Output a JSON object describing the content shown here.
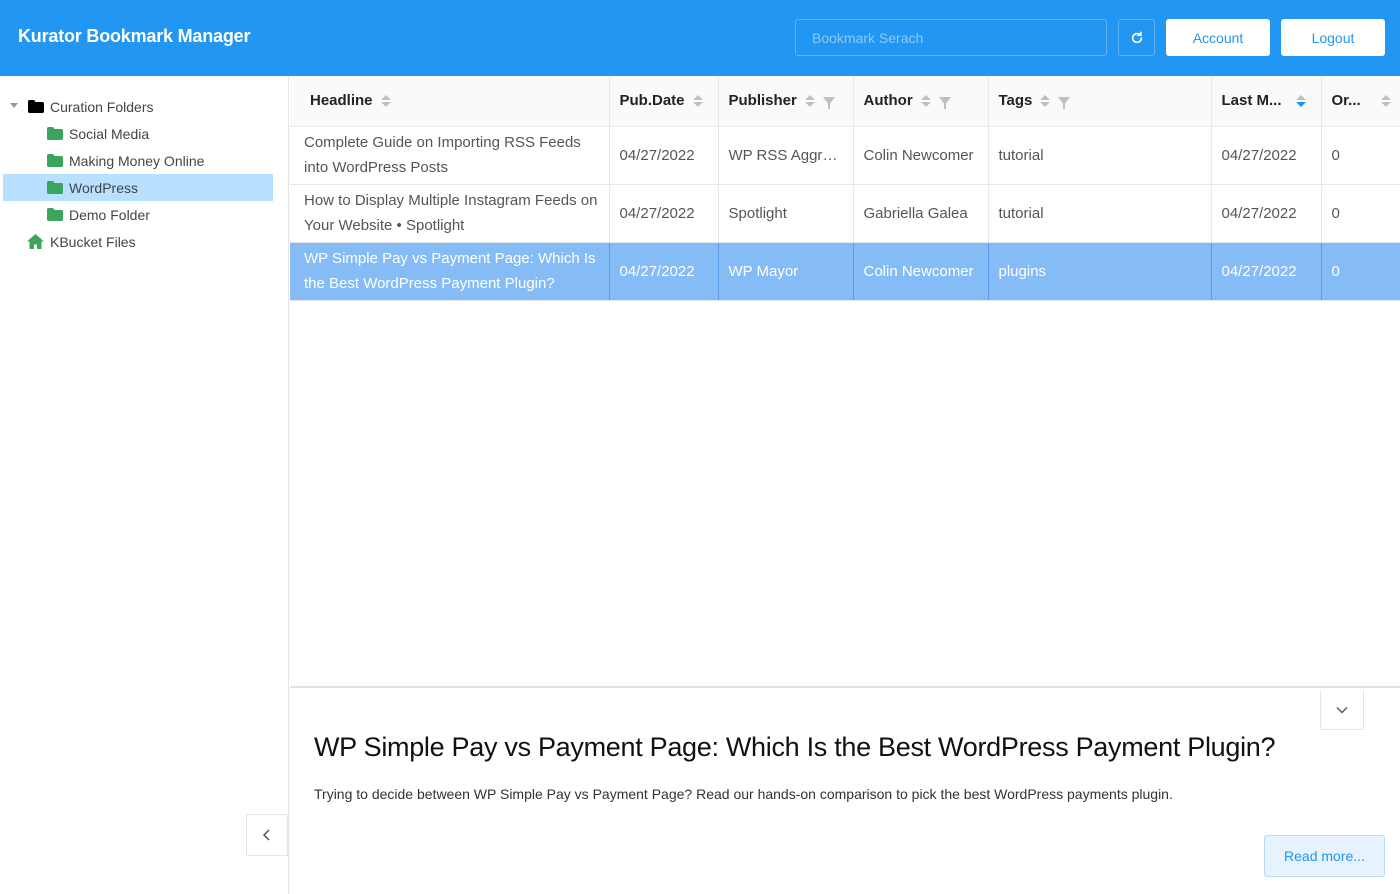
{
  "header": {
    "title": "Kurator Bookmark Manager",
    "search_placeholder": "Bookmark Serach",
    "account_label": "Account",
    "logout_label": "Logout"
  },
  "sidebar": {
    "root": {
      "label": "Curation Folders",
      "icon": "folder-icon"
    },
    "folders": [
      {
        "label": "Social Media",
        "icon": "folder-icon",
        "color": "#3ba55d"
      },
      {
        "label": "Making Money Online",
        "icon": "folder-icon",
        "color": "#3ba55d"
      },
      {
        "label": "WordPress",
        "icon": "folder-icon",
        "color": "#3ba55d",
        "selected": true
      },
      {
        "label": "Demo Folder",
        "icon": "folder-icon",
        "color": "#3ba55d"
      }
    ],
    "files": {
      "label": "KBucket Files",
      "icon": "home-icon",
      "color": "#3ba55d"
    }
  },
  "table": {
    "columns": [
      "Headline",
      "Pub.Date",
      "Publisher",
      "Author",
      "Tags",
      "Last M...",
      "Or..."
    ],
    "rows": [
      {
        "headline": "Complete Guide on Importing RSS Feeds into WordPress Posts",
        "pub_date": "04/27/2022",
        "publisher": "WP RSS Aggre...",
        "author": "Colin Newcomer",
        "tags": "tutorial",
        "last_modified": "04/27/2022",
        "order": "0"
      },
      {
        "headline": "How to Display Multiple Instagram Feeds on Your Website • Spotlight",
        "pub_date": "04/27/2022",
        "publisher": "Spotlight",
        "author": "Gabriella Galea",
        "tags": "tutorial",
        "last_modified": "04/27/2022",
        "order": "0"
      },
      {
        "headline": "WP Simple Pay vs Payment Page: Which Is the Best WordPress Payment Plugin?",
        "pub_date": "04/27/2022",
        "publisher": "WP Mayor",
        "author": "Colin Newcomer",
        "tags": "plugins",
        "last_modified": "04/27/2022",
        "order": "0",
        "selected": true
      }
    ]
  },
  "preview": {
    "title": "WP Simple Pay vs Payment Page: Which Is the Best WordPress Payment Plugin?",
    "description": "Trying to decide between WP Simple Pay vs Payment Page? Read our hands-on comparison to pick the best WordPress payments plugin.",
    "read_more_label": "Read more..."
  },
  "colors": {
    "header_bg": "#2196f3",
    "selected_row": "#85bcf6",
    "selected_tree": "#bae0ff",
    "folder_green": "#3ba55d"
  }
}
